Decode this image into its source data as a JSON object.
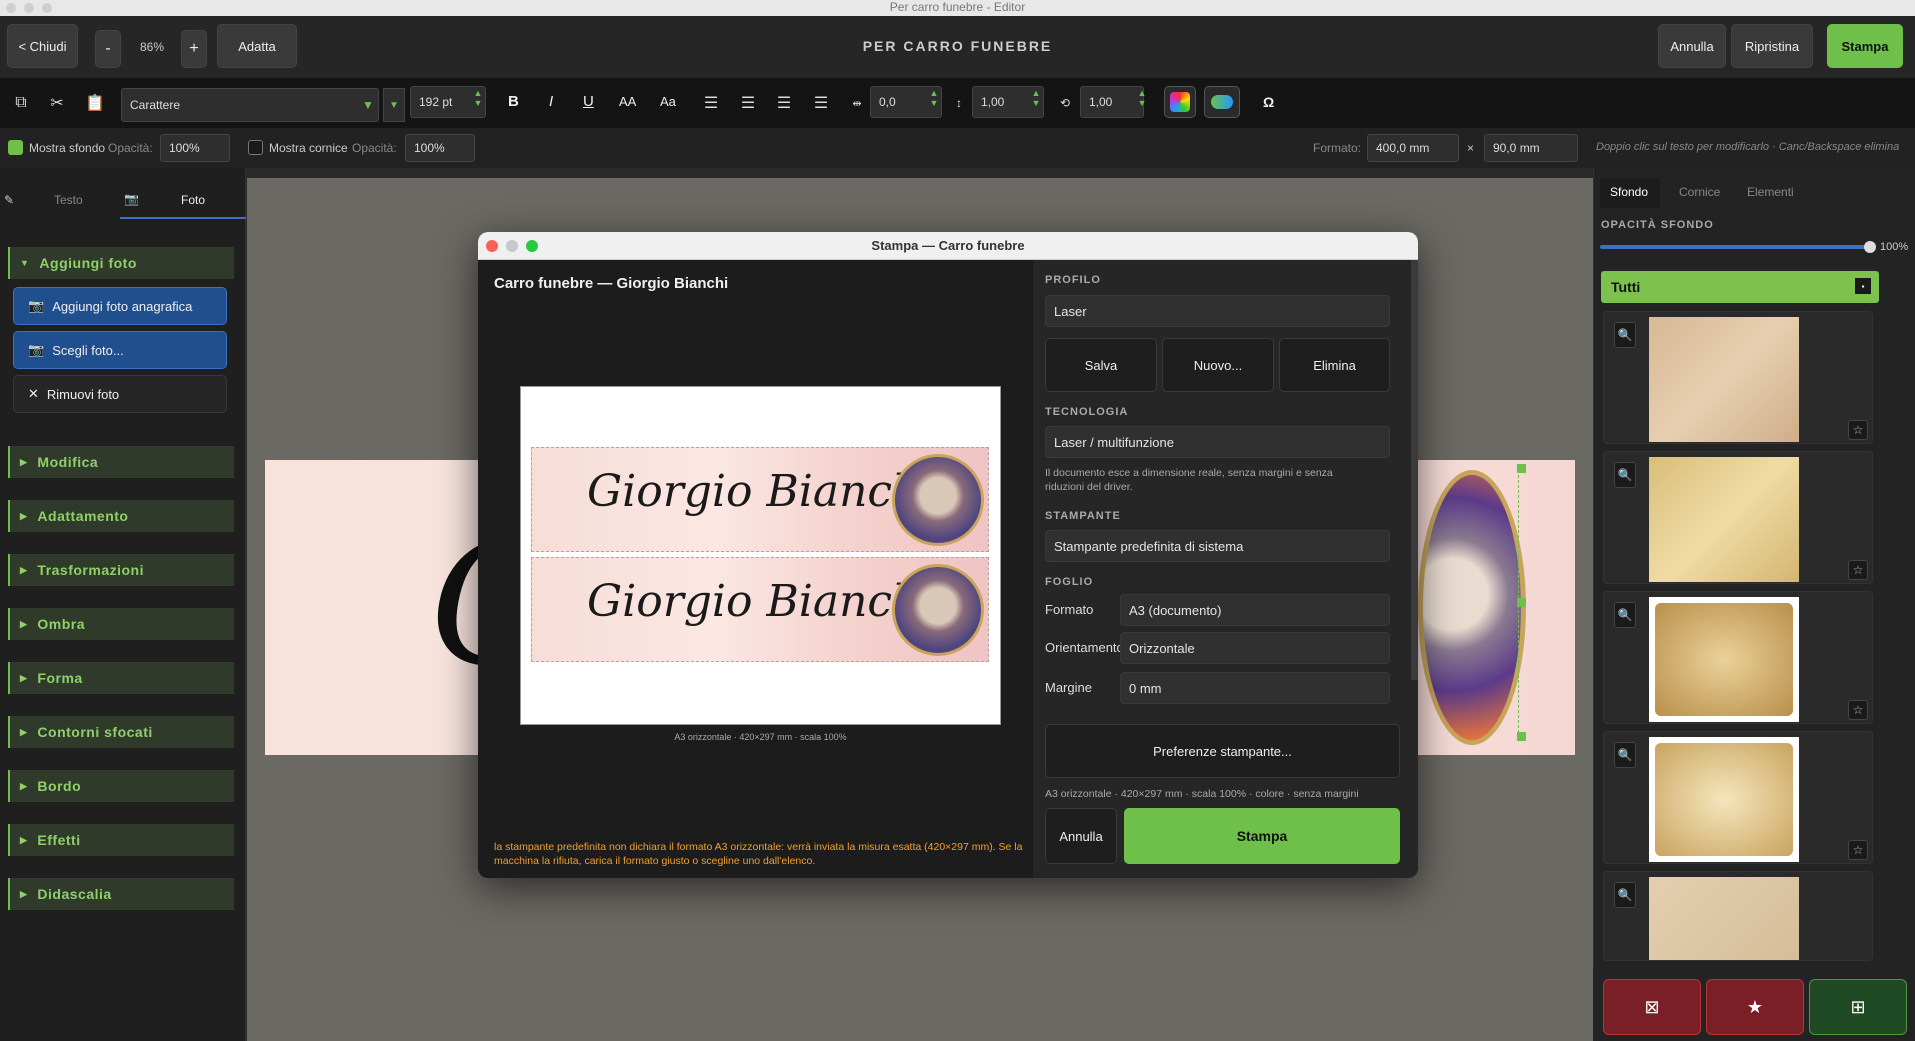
{
  "window": {
    "title": "Per carro funebre - Editor"
  },
  "topbar": {
    "close": "< Chiudi",
    "zoom_minus": "-",
    "zoom": "86%",
    "zoom_plus": "+",
    "fit": "Adatta",
    "doc_title": "PER CARRO FUNEBRE",
    "undo": "Annulla",
    "redo": "Ripristina",
    "print": "Stampa"
  },
  "toolbar": {
    "font": "Carattere",
    "size": "192 pt",
    "bold": "B",
    "italic": "I",
    "underline": "U",
    "upper": "AA",
    "case": "Aa",
    "tracking": "0,0",
    "leading": "1,00",
    "scale": "1,00",
    "omega": "Ω"
  },
  "options": {
    "show_bg": "Mostra sfondo",
    "opacity1_label": "Opacità:",
    "opacity1": "100%",
    "show_frame": "Mostra cornice",
    "opacity2_label": "Opacità:",
    "opacity2": "100%",
    "format_label": "Formato:",
    "width": "400,0 mm",
    "x": "×",
    "height": "90,0 mm",
    "hint": "Doppio clic sul testo per modificarlo · Canc/Backspace elimina"
  },
  "left": {
    "tabs": [
      "Testo",
      "Foto"
    ],
    "sections": [
      "Aggiungi foto",
      "Modifica",
      "Adattamento",
      "Trasformazioni",
      "Ombra",
      "Forma",
      "Contorni sfocati",
      "Bordo",
      "Effetti",
      "Didascalia"
    ],
    "add_portrait": "Aggiungi foto anagrafica",
    "choose": "Scegli foto...",
    "remove": "Rimuovi foto"
  },
  "right": {
    "tabs": [
      "Sfondo",
      "Cornice",
      "Elementi"
    ],
    "opacity_label": "OPACITÀ SFONDO",
    "opacity_value": "100%",
    "opacity_fraction": 1.0,
    "category": "Tutti"
  },
  "modal": {
    "title": "Stampa — Carro funebre",
    "preview_title": "Carro funebre — Giorgio Bianchi",
    "name": "Giorgio Bianchi",
    "preview_caption": "A3 orizzontale · 420×297 mm · scala 100%",
    "warning": "la stampante predefinita non dichiara il formato A3 orizzontale: verrà inviata la misura esatta (420×297 mm). Se la macchina la rifiuta, carica il formato giusto o scegline uno dall'elenco.",
    "profile_label": "PROFILO",
    "profile": "Laser",
    "save": "Salva",
    "new": "Nuovo...",
    "delete": "Elimina",
    "tech_label": "TECNOLOGIA",
    "tech": "Laser / multifunzione",
    "tech_note": "Il documento esce a dimensione reale, senza margini e senza riduzioni del driver.",
    "printer_label": "STAMPANTE",
    "printer": "Stampante predefinita di sistema",
    "sheet_label": "FOGLIO",
    "format_label": "Formato",
    "format": "A3  (documento)",
    "orient_label": "Orientamento",
    "orient": "Orizzontale",
    "margin_label": "Margine",
    "margin": "0 mm",
    "prefs": "Preferenze stampante...",
    "summary": "A3 orizzontale · 420×297 mm · scala 100% · colore · senza margini",
    "cancel": "Annulla",
    "print": "Stampa"
  }
}
